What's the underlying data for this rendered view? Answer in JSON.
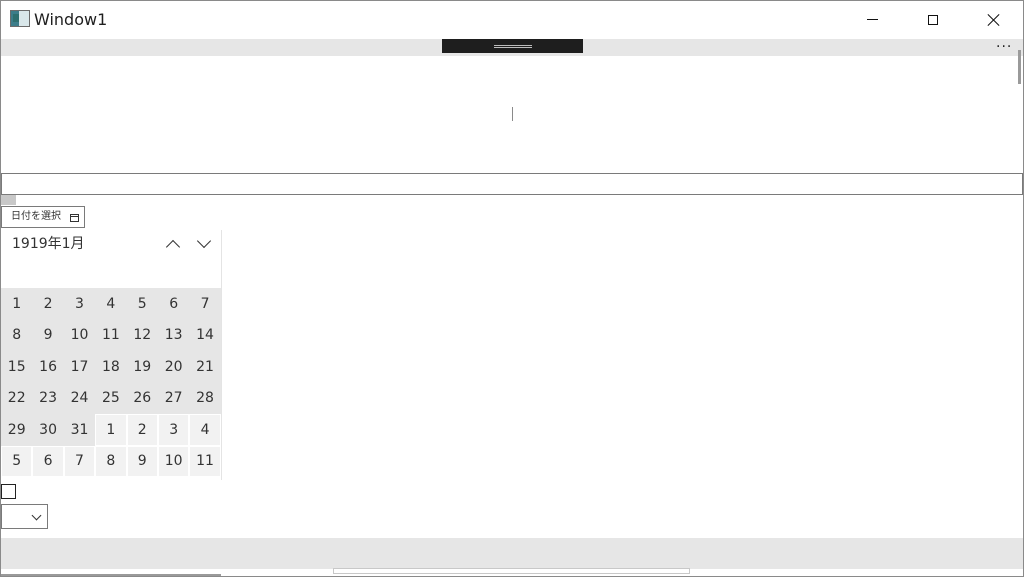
{
  "window": {
    "title": "Window1"
  },
  "caption_buttons": {
    "minimize": "minimize",
    "maximize": "maximize",
    "close": "close"
  },
  "toolbar": {
    "more_label": "···"
  },
  "datepicker": {
    "placeholder": "日付を選択"
  },
  "calendar": {
    "header": "1919年1月",
    "days": [
      {
        "d": "1",
        "t": "cur"
      },
      {
        "d": "2",
        "t": "cur"
      },
      {
        "d": "3",
        "t": "cur"
      },
      {
        "d": "4",
        "t": "cur"
      },
      {
        "d": "5",
        "t": "cur"
      },
      {
        "d": "6",
        "t": "cur"
      },
      {
        "d": "7",
        "t": "cur"
      },
      {
        "d": "8",
        "t": "cur"
      },
      {
        "d": "9",
        "t": "cur"
      },
      {
        "d": "10",
        "t": "cur"
      },
      {
        "d": "11",
        "t": "cur"
      },
      {
        "d": "12",
        "t": "cur"
      },
      {
        "d": "13",
        "t": "cur"
      },
      {
        "d": "14",
        "t": "cur"
      },
      {
        "d": "15",
        "t": "cur"
      },
      {
        "d": "16",
        "t": "cur"
      },
      {
        "d": "17",
        "t": "cur"
      },
      {
        "d": "18",
        "t": "cur"
      },
      {
        "d": "19",
        "t": "cur"
      },
      {
        "d": "20",
        "t": "cur"
      },
      {
        "d": "21",
        "t": "cur"
      },
      {
        "d": "22",
        "t": "cur"
      },
      {
        "d": "23",
        "t": "cur"
      },
      {
        "d": "24",
        "t": "cur"
      },
      {
        "d": "25",
        "t": "cur"
      },
      {
        "d": "26",
        "t": "cur"
      },
      {
        "d": "27",
        "t": "cur"
      },
      {
        "d": "28",
        "t": "cur"
      },
      {
        "d": "29",
        "t": "cur"
      },
      {
        "d": "30",
        "t": "cur"
      },
      {
        "d": "31",
        "t": "cur"
      },
      {
        "d": "1",
        "t": "out"
      },
      {
        "d": "2",
        "t": "out"
      },
      {
        "d": "3",
        "t": "out"
      },
      {
        "d": "4",
        "t": "out"
      },
      {
        "d": "5",
        "t": "out"
      },
      {
        "d": "6",
        "t": "out"
      },
      {
        "d": "7",
        "t": "out"
      },
      {
        "d": "8",
        "t": "out"
      },
      {
        "d": "9",
        "t": "out"
      },
      {
        "d": "10",
        "t": "out"
      },
      {
        "d": "11",
        "t": "out"
      }
    ]
  },
  "colors": {
    "bar": "#e6e6e6",
    "handle": "#1e1e1e",
    "current_month_day": "#e6e6e6",
    "other_month_day": "#f2f2f2"
  }
}
